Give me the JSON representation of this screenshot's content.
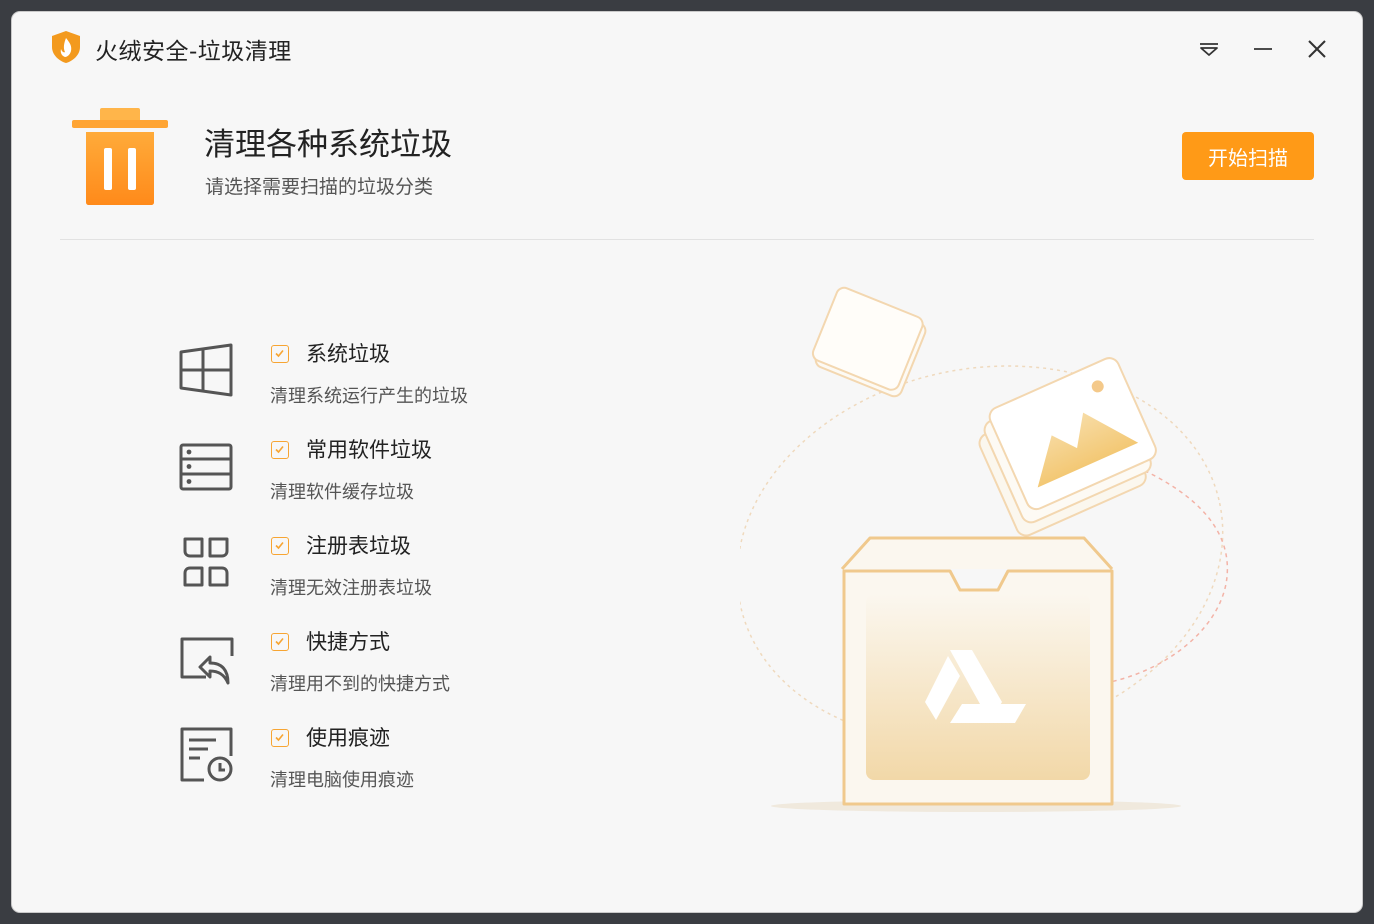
{
  "window": {
    "title": "火绒安全-垃圾清理",
    "controls": [
      "menu-icon",
      "minimize-icon",
      "close-icon"
    ]
  },
  "header": {
    "title": "清理各种系统垃圾",
    "subtitle": "请选择需要扫描的垃圾分类",
    "scan_button": "开始扫描"
  },
  "categories": [
    {
      "icon": "windows-icon",
      "checked": true,
      "name": "系统垃圾",
      "desc": "清理系统运行产生的垃圾"
    },
    {
      "icon": "software-list-icon",
      "checked": true,
      "name": "常用软件垃圾",
      "desc": "清理软件缓存垃圾"
    },
    {
      "icon": "registry-icon",
      "checked": true,
      "name": "注册表垃圾",
      "desc": "清理无效注册表垃圾"
    },
    {
      "icon": "shortcut-icon",
      "checked": true,
      "name": "快捷方式",
      "desc": "清理用不到的快捷方式"
    },
    {
      "icon": "history-icon",
      "checked": true,
      "name": "使用痕迹",
      "desc": "清理电脑使用痕迹"
    }
  ],
  "colors": {
    "accent": "#ff9a17",
    "checkbox": "#f7a533",
    "background": "#f7f7f7"
  }
}
